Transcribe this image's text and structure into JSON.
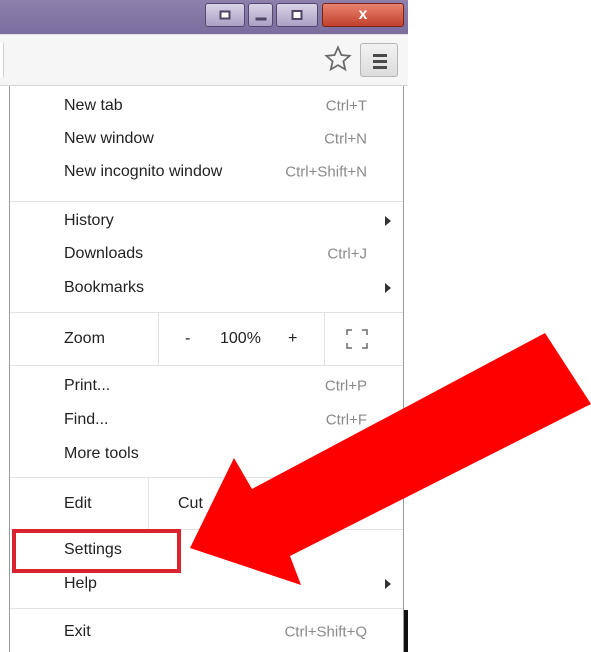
{
  "window_controls": {
    "close_glyph": "x"
  },
  "menu": {
    "items_group1": [
      {
        "label": "New tab",
        "shortcut": "Ctrl+T"
      },
      {
        "label": "New window",
        "shortcut": "Ctrl+N"
      },
      {
        "label": "New incognito window",
        "shortcut": "Ctrl+Shift+N"
      }
    ],
    "items_group2": [
      {
        "label": "History",
        "has_submenu": true
      },
      {
        "label": "Downloads",
        "shortcut": "Ctrl+J"
      },
      {
        "label": "Bookmarks",
        "has_submenu": true
      }
    ],
    "zoom": {
      "label": "Zoom",
      "minus": "-",
      "value": "100%",
      "plus": "+",
      "fullscreen_icon": "fullscreen-icon"
    },
    "items_group3": [
      {
        "label": "Print...",
        "shortcut": "Ctrl+P"
      },
      {
        "label": "Find...",
        "shortcut": "Ctrl+F"
      },
      {
        "label": "More tools"
      }
    ],
    "edit": {
      "label": "Edit",
      "cut": "Cut"
    },
    "items_group4": [
      {
        "label": "Settings"
      },
      {
        "label": "Help",
        "has_submenu": true
      }
    ],
    "exit": {
      "label": "Exit",
      "shortcut": "Ctrl+Shift+Q"
    }
  },
  "annotation": {
    "highlight_color": "#d9232e",
    "arrow_color": "#ff0000"
  },
  "toolbar": {
    "star_icon": "star-icon",
    "menu_icon": "hamburger-menu-icon"
  }
}
